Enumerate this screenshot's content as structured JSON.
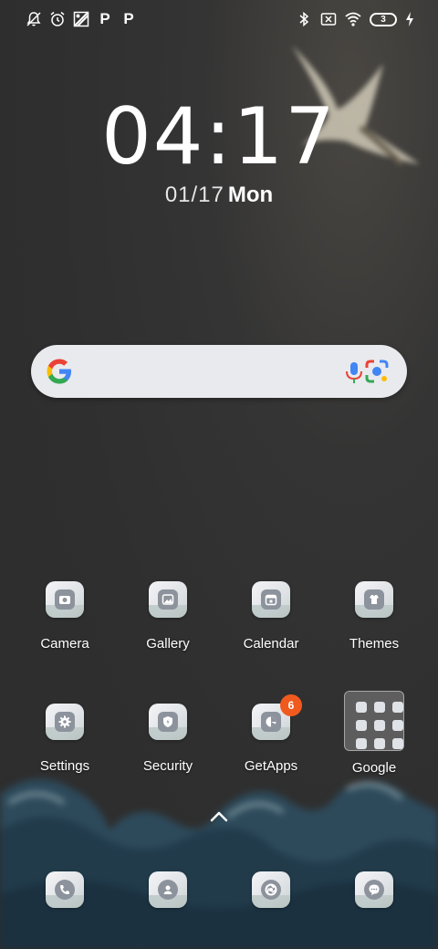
{
  "statusbar": {
    "left_icons": [
      "notifications-off-icon",
      "alarm-icon",
      "app-icon",
      "p-app-icon",
      "p-app-icon"
    ],
    "p_label_1": "P",
    "p_label_2": "P",
    "right_icons": [
      "bluetooth-icon",
      "no-sim-icon",
      "wifi-icon",
      "battery-icon",
      "charging-icon"
    ],
    "battery_level": "3"
  },
  "clock": {
    "hours": "04",
    "sep": ":",
    "minutes": "17"
  },
  "date": {
    "day": "01/17",
    "weekday": "Mon"
  },
  "search": {
    "left_icon": "google-g-icon",
    "mic_icon": "microphone-icon",
    "lens_icon": "google-lens-icon"
  },
  "apps_row1": [
    {
      "label": "Camera",
      "icon": "camera-icon"
    },
    {
      "label": "Gallery",
      "icon": "gallery-icon"
    },
    {
      "label": "Calendar",
      "icon": "calendar-icon"
    },
    {
      "label": "Themes",
      "icon": "themes-icon"
    }
  ],
  "apps_row2": [
    {
      "label": "Settings",
      "icon": "settings-icon"
    },
    {
      "label": "Security",
      "icon": "security-icon"
    },
    {
      "label": "GetApps",
      "icon": "getapps-icon",
      "badge": "6"
    },
    {
      "label": "Google",
      "icon": "folder-icon"
    }
  ],
  "dock": [
    {
      "icon": "phone-icon"
    },
    {
      "icon": "contacts-icon"
    },
    {
      "icon": "browser-icon"
    },
    {
      "icon": "messages-icon"
    }
  ],
  "colors": {
    "background": "#2f2f2f",
    "badge": "#f05a1e",
    "searchbar": "#e9eaee",
    "icon_glyph": "#8d939c"
  }
}
